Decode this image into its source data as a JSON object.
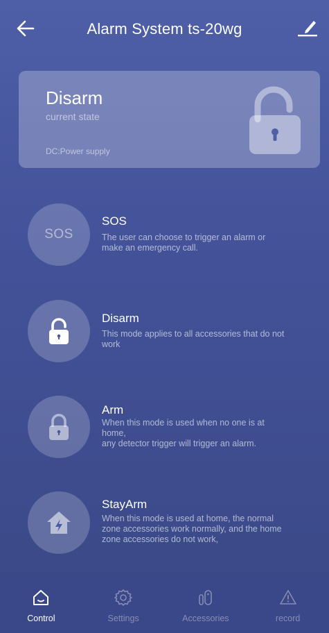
{
  "header": {
    "title": "Alarm System ts-20wg",
    "back_icon": "arrow-left-icon",
    "edit_icon": "edit-pencil-icon"
  },
  "status": {
    "state": "Disarm",
    "caption": "current state",
    "power": "DC:Power supply",
    "icon": "unlocked-padlock-icon"
  },
  "modes": [
    {
      "name": "SOS",
      "icon_text": "SOS",
      "desc_lines": [
        "The user can choose to trigger an alarm or",
        "make an emergency call."
      ]
    },
    {
      "name": "Disarm",
      "icon": "unlocked-padlock-icon",
      "desc_lines": [
        "This mode applies to all accessories that do not",
        "work"
      ]
    },
    {
      "name": "Arm",
      "icon": "locked-padlock-icon",
      "desc_lines": [
        "When this mode is used when no one is at",
        "home,",
        "any detector trigger will trigger an alarm."
      ]
    },
    {
      "name": "StayArm",
      "icon": "home-bolt-icon",
      "desc_lines": [
        "When this mode is used at home, the normal",
        "zone accessories work normally, and the home",
        "zone accessories do not work,"
      ]
    }
  ],
  "tabs": [
    {
      "label": "Control",
      "icon": "home-icon",
      "active": true
    },
    {
      "label": "Settings",
      "icon": "gear-icon",
      "active": false
    },
    {
      "label": "Accessories",
      "icon": "sensor-icon",
      "active": false
    },
    {
      "label": "record",
      "icon": "warning-triangle-icon",
      "active": false
    }
  ],
  "colors": {
    "background_top": "#4e5fa8",
    "background_bottom": "#3a4886",
    "tabbar": "#3a4788",
    "text_primary": "#ffffff"
  }
}
